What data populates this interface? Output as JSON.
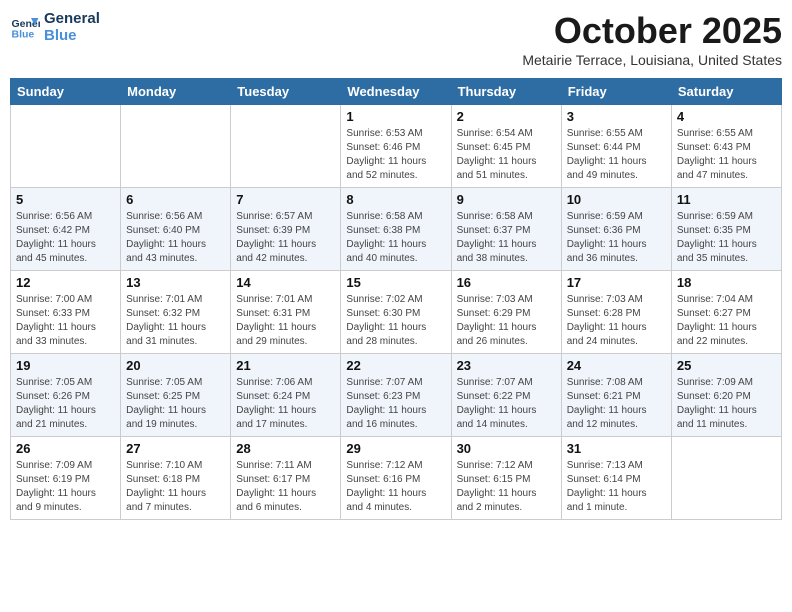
{
  "header": {
    "logo_line1": "General",
    "logo_line2": "Blue",
    "month": "October 2025",
    "location": "Metairie Terrace, Louisiana, United States"
  },
  "days_of_week": [
    "Sunday",
    "Monday",
    "Tuesday",
    "Wednesday",
    "Thursday",
    "Friday",
    "Saturday"
  ],
  "weeks": [
    [
      {
        "day": "",
        "info": ""
      },
      {
        "day": "",
        "info": ""
      },
      {
        "day": "",
        "info": ""
      },
      {
        "day": "1",
        "info": "Sunrise: 6:53 AM\nSunset: 6:46 PM\nDaylight: 11 hours\nand 52 minutes."
      },
      {
        "day": "2",
        "info": "Sunrise: 6:54 AM\nSunset: 6:45 PM\nDaylight: 11 hours\nand 51 minutes."
      },
      {
        "day": "3",
        "info": "Sunrise: 6:55 AM\nSunset: 6:44 PM\nDaylight: 11 hours\nand 49 minutes."
      },
      {
        "day": "4",
        "info": "Sunrise: 6:55 AM\nSunset: 6:43 PM\nDaylight: 11 hours\nand 47 minutes."
      }
    ],
    [
      {
        "day": "5",
        "info": "Sunrise: 6:56 AM\nSunset: 6:42 PM\nDaylight: 11 hours\nand 45 minutes."
      },
      {
        "day": "6",
        "info": "Sunrise: 6:56 AM\nSunset: 6:40 PM\nDaylight: 11 hours\nand 43 minutes."
      },
      {
        "day": "7",
        "info": "Sunrise: 6:57 AM\nSunset: 6:39 PM\nDaylight: 11 hours\nand 42 minutes."
      },
      {
        "day": "8",
        "info": "Sunrise: 6:58 AM\nSunset: 6:38 PM\nDaylight: 11 hours\nand 40 minutes."
      },
      {
        "day": "9",
        "info": "Sunrise: 6:58 AM\nSunset: 6:37 PM\nDaylight: 11 hours\nand 38 minutes."
      },
      {
        "day": "10",
        "info": "Sunrise: 6:59 AM\nSunset: 6:36 PM\nDaylight: 11 hours\nand 36 minutes."
      },
      {
        "day": "11",
        "info": "Sunrise: 6:59 AM\nSunset: 6:35 PM\nDaylight: 11 hours\nand 35 minutes."
      }
    ],
    [
      {
        "day": "12",
        "info": "Sunrise: 7:00 AM\nSunset: 6:33 PM\nDaylight: 11 hours\nand 33 minutes."
      },
      {
        "day": "13",
        "info": "Sunrise: 7:01 AM\nSunset: 6:32 PM\nDaylight: 11 hours\nand 31 minutes."
      },
      {
        "day": "14",
        "info": "Sunrise: 7:01 AM\nSunset: 6:31 PM\nDaylight: 11 hours\nand 29 minutes."
      },
      {
        "day": "15",
        "info": "Sunrise: 7:02 AM\nSunset: 6:30 PM\nDaylight: 11 hours\nand 28 minutes."
      },
      {
        "day": "16",
        "info": "Sunrise: 7:03 AM\nSunset: 6:29 PM\nDaylight: 11 hours\nand 26 minutes."
      },
      {
        "day": "17",
        "info": "Sunrise: 7:03 AM\nSunset: 6:28 PM\nDaylight: 11 hours\nand 24 minutes."
      },
      {
        "day": "18",
        "info": "Sunrise: 7:04 AM\nSunset: 6:27 PM\nDaylight: 11 hours\nand 22 minutes."
      }
    ],
    [
      {
        "day": "19",
        "info": "Sunrise: 7:05 AM\nSunset: 6:26 PM\nDaylight: 11 hours\nand 21 minutes."
      },
      {
        "day": "20",
        "info": "Sunrise: 7:05 AM\nSunset: 6:25 PM\nDaylight: 11 hours\nand 19 minutes."
      },
      {
        "day": "21",
        "info": "Sunrise: 7:06 AM\nSunset: 6:24 PM\nDaylight: 11 hours\nand 17 minutes."
      },
      {
        "day": "22",
        "info": "Sunrise: 7:07 AM\nSunset: 6:23 PM\nDaylight: 11 hours\nand 16 minutes."
      },
      {
        "day": "23",
        "info": "Sunrise: 7:07 AM\nSunset: 6:22 PM\nDaylight: 11 hours\nand 14 minutes."
      },
      {
        "day": "24",
        "info": "Sunrise: 7:08 AM\nSunset: 6:21 PM\nDaylight: 11 hours\nand 12 minutes."
      },
      {
        "day": "25",
        "info": "Sunrise: 7:09 AM\nSunset: 6:20 PM\nDaylight: 11 hours\nand 11 minutes."
      }
    ],
    [
      {
        "day": "26",
        "info": "Sunrise: 7:09 AM\nSunset: 6:19 PM\nDaylight: 11 hours\nand 9 minutes."
      },
      {
        "day": "27",
        "info": "Sunrise: 7:10 AM\nSunset: 6:18 PM\nDaylight: 11 hours\nand 7 minutes."
      },
      {
        "day": "28",
        "info": "Sunrise: 7:11 AM\nSunset: 6:17 PM\nDaylight: 11 hours\nand 6 minutes."
      },
      {
        "day": "29",
        "info": "Sunrise: 7:12 AM\nSunset: 6:16 PM\nDaylight: 11 hours\nand 4 minutes."
      },
      {
        "day": "30",
        "info": "Sunrise: 7:12 AM\nSunset: 6:15 PM\nDaylight: 11 hours\nand 2 minutes."
      },
      {
        "day": "31",
        "info": "Sunrise: 7:13 AM\nSunset: 6:14 PM\nDaylight: 11 hours\nand 1 minute."
      },
      {
        "day": "",
        "info": ""
      }
    ]
  ]
}
